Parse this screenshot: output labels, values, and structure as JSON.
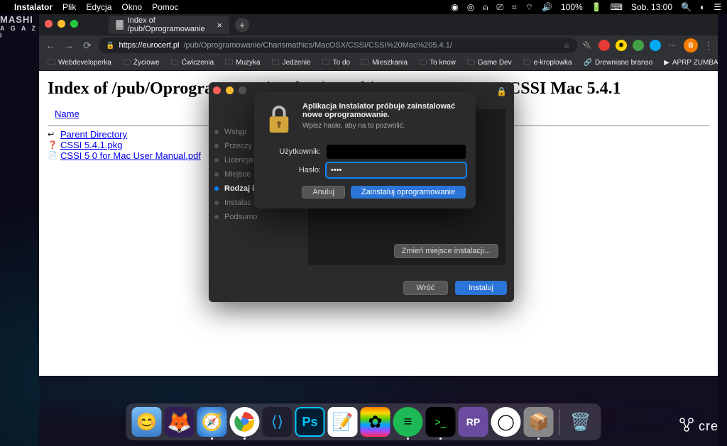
{
  "menubar": {
    "app": "Instalator",
    "items": [
      "Plik",
      "Edycja",
      "Okno",
      "Pomoc"
    ],
    "battery": "100%",
    "clock": "Sob. 13:00"
  },
  "browser": {
    "tab_title": "Index of /pub/Oprogramowanie",
    "url_secure": "https://eurocert.pl",
    "url_path": "/pub/Oprogramowanie/Charismathics/MacOSX/CSSI/CSSI%20Mac%205.4.1/",
    "bookmarks": [
      "Webdeveloperka",
      "Życiowe",
      "Ćwiczenia",
      "Muzyka",
      "Jedzenie",
      "To do",
      "Mieszkania",
      "To know",
      "Game Dev",
      "e-kroplowka",
      "Drewniane branso",
      "APRP ZUMBA - Z..."
    ]
  },
  "page": {
    "heading": "Index of /pub/Oprogramowanie/Charismathics/MacOSX/CSSI/CSSI Mac 5.4.1",
    "th_name": "Name",
    "rows": [
      {
        "label": "Parent Directory",
        "icon": "↩"
      },
      {
        "label": "CSSI 5.4.1.pkg",
        "icon": "❓"
      },
      {
        "label": "CSSI 5 0 for Mac User Manual.pdf",
        "icon": "📄"
      }
    ]
  },
  "installer": {
    "steps": [
      "Wstęp",
      "Przeczy",
      "Licencja",
      "Miejsce",
      "Rodzaj i",
      "Instalac",
      "Podsumo"
    ],
    "active_index": 4,
    "change_loc": "Zmień miejsce instalacji...",
    "back": "Wróć",
    "install": "Instaluj"
  },
  "sudo": {
    "line1": "Aplikacja Instalator próbuje zainstalować nowe oprogramowanie.",
    "line2": "Wpisz hasło, aby na to pozwolić.",
    "user_label": "Użytkownik:",
    "pass_label": "Hasło:",
    "pass_value": "••••",
    "cancel": "Anuluj",
    "ok": "Zainstaluj oprogramowanie"
  },
  "corner": {
    "text": "cre"
  },
  "mashed": {
    "l1": "MASHI",
    "l2": "A G A Z I"
  }
}
